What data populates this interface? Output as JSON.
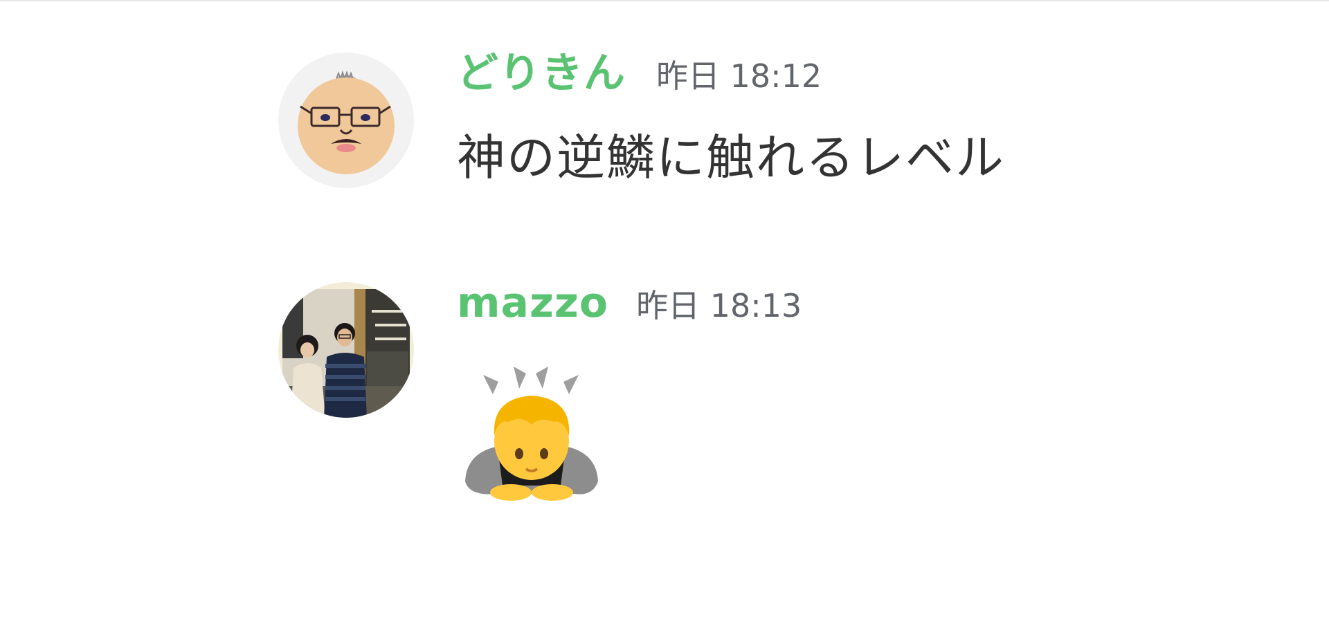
{
  "messages": [
    {
      "username": "どりきん",
      "timestamp": "昨日 18:12",
      "text": "神の逆鱗に触れるレベル",
      "avatar": "illustrated-man-glasses-avatar"
    },
    {
      "username": "mazzo",
      "timestamp": "昨日 18:13",
      "emoji": "person-bowing-emoji",
      "avatar": "couple-photo-avatar"
    }
  ],
  "colors": {
    "username": "#5ac372",
    "timestamp": "#62656b",
    "text": "#333333",
    "divider": "#e6e6e6"
  }
}
